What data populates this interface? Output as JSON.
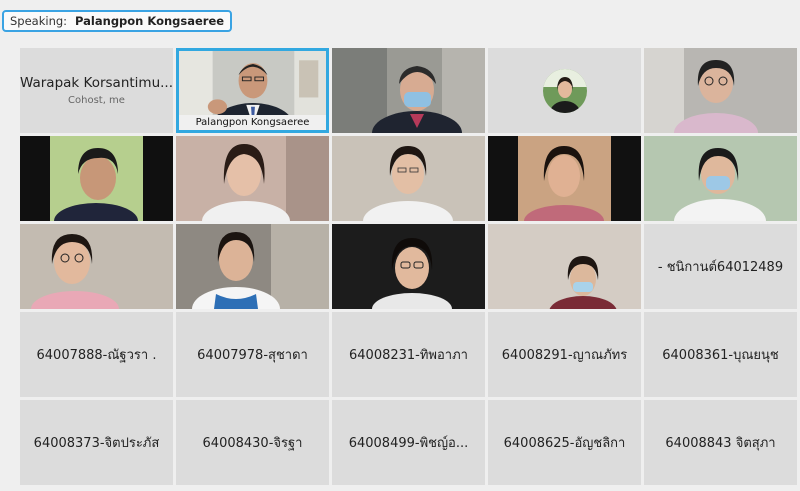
{
  "speaking": {
    "label": "Speaking:",
    "name": "Palangpon Kongsaeree"
  },
  "tiles": {
    "r1c1": {
      "name": "Warapak Korsantimu...",
      "subtitle": "Cohost, me"
    },
    "r1c2": {
      "caption": "Palangpon Kongsaeree"
    },
    "r3c5": {
      "name": "- ชนิกานต์64012489"
    },
    "r4c1": {
      "name": "64007888-ณัฐวรา ."
    },
    "r4c2": {
      "name": "64007978-สุชาดา"
    },
    "r4c3": {
      "name": "64008231-ทิพอาภา"
    },
    "r4c4": {
      "name": "64008291-ญาณภัทร"
    },
    "r4c5": {
      "name": "64008361-บุณยนุช"
    },
    "r5c1": {
      "name": "64008373-จิตประภัส"
    },
    "r5c2": {
      "name": "64008430-จิรฐา"
    },
    "r5c3": {
      "name": "64008499-พิชญ์อ..."
    },
    "r5c4": {
      "name": "64008625-อัญชลิกา"
    },
    "r5c5": {
      "name": "64008843 จิตสุภา"
    }
  },
  "colors": {
    "accent": "#32a8e0",
    "tile_bg": "#dcdcdc",
    "page_bg": "#efefef"
  }
}
